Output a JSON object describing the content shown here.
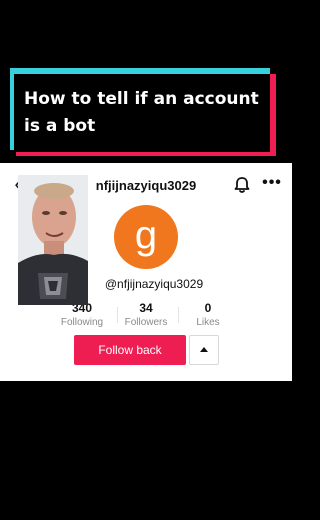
{
  "caption": {
    "text": "How to tell if an account is a bot"
  },
  "profile": {
    "username_title": "nfjijnazyiqu3029",
    "avatar_letter": "g",
    "avatar_color": "#f0771e",
    "handle": "@nfjijnazyiqu3029",
    "stats": [
      {
        "value": "340",
        "label": "Following"
      },
      {
        "value": "34",
        "label": "Followers"
      },
      {
        "value": "0",
        "label": "Likes"
      }
    ],
    "follow_back_label": "Follow back",
    "accent_color": "#ee1d52"
  },
  "icons": {
    "back": "‹",
    "more": "•••"
  }
}
